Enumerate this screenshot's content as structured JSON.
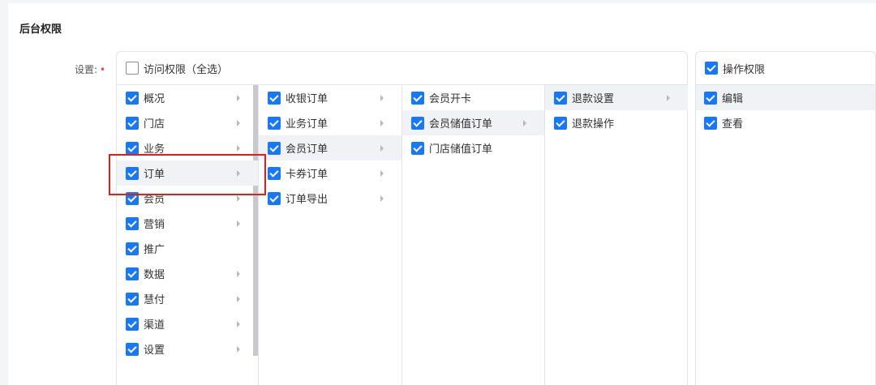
{
  "section_title": "后台权限",
  "setting_label": "设置:",
  "required_mark": "•",
  "access": {
    "label": "访问权限（全选）",
    "checked": false
  },
  "columns": {
    "c1": [
      {
        "label": "概况",
        "checked": true,
        "has_children": true
      },
      {
        "label": "门店",
        "checked": true,
        "has_children": true
      },
      {
        "label": "业务",
        "checked": true,
        "has_children": true
      },
      {
        "label": "订单",
        "checked": true,
        "has_children": true,
        "active": true
      },
      {
        "label": "会员",
        "checked": true,
        "has_children": true
      },
      {
        "label": "营销",
        "checked": true,
        "has_children": true
      },
      {
        "label": "推广",
        "checked": true,
        "has_children": false
      },
      {
        "label": "数据",
        "checked": true,
        "has_children": true
      },
      {
        "label": "慧付",
        "checked": true,
        "has_children": true
      },
      {
        "label": "渠道",
        "checked": true,
        "has_children": true
      },
      {
        "label": "设置",
        "checked": true,
        "has_children": true
      }
    ],
    "c2": [
      {
        "label": "收银订单",
        "checked": true,
        "has_children": true
      },
      {
        "label": "业务订单",
        "checked": true,
        "has_children": true
      },
      {
        "label": "会员订单",
        "checked": true,
        "has_children": true,
        "active": true
      },
      {
        "label": "卡券订单",
        "checked": true,
        "has_children": true
      },
      {
        "label": "订单导出",
        "checked": true,
        "has_children": true
      }
    ],
    "c3": [
      {
        "label": "会员开卡",
        "checked": true,
        "has_children": false
      },
      {
        "label": "会员储值订单",
        "checked": true,
        "has_children": true,
        "active": true
      },
      {
        "label": "门店储值订单",
        "checked": true,
        "has_children": false
      }
    ],
    "c4": [
      {
        "label": "退款设置",
        "checked": true,
        "has_children": true,
        "active": true
      },
      {
        "label": "退款操作",
        "checked": true,
        "has_children": false
      }
    ]
  },
  "operations": {
    "header": {
      "label": "操作权限",
      "checked": true
    },
    "items": [
      {
        "label": "编辑",
        "checked": true,
        "active": true
      },
      {
        "label": "查看",
        "checked": true
      }
    ]
  },
  "colors": {
    "accent": "#1677ff",
    "highlight": "#e11d1d",
    "required": "#e84a4a"
  }
}
